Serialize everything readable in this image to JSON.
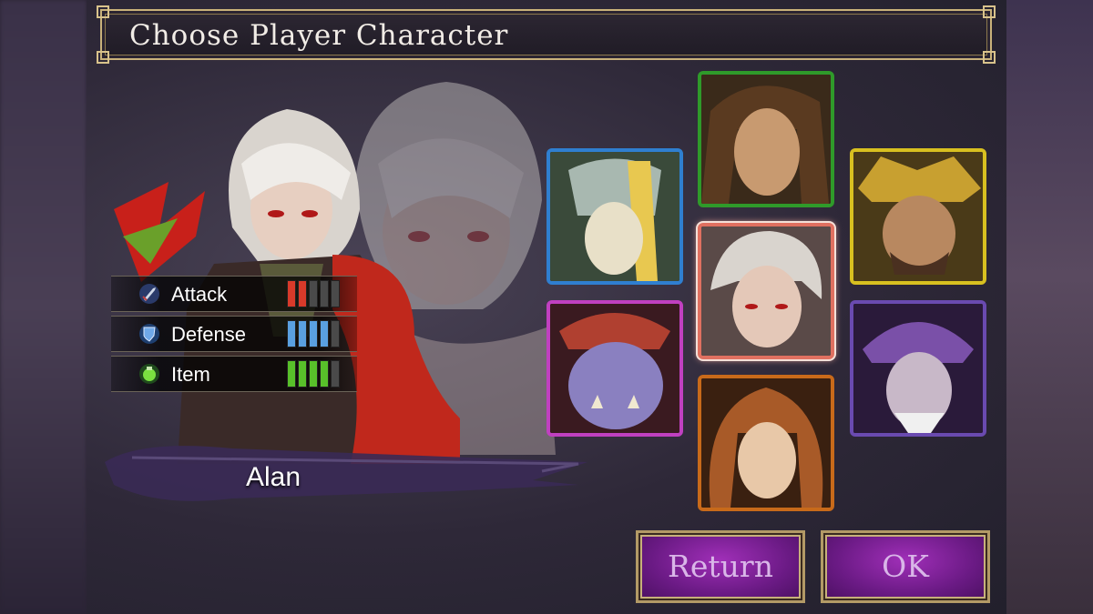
{
  "header": {
    "title": "Choose Player Character"
  },
  "selected": {
    "name": "Alan",
    "stats": [
      {
        "label": "Attack",
        "icon": "sword-icon",
        "filled": 2,
        "total": 5,
        "color": "#d83a2a"
      },
      {
        "label": "Defense",
        "icon": "shield-icon",
        "filled": 4,
        "total": 5,
        "color": "#5aa0e0"
      },
      {
        "label": "Item",
        "icon": "potion-icon",
        "filled": 4,
        "total": 5,
        "color": "#58c02a"
      }
    ]
  },
  "characters": [
    {
      "id": "valkyrie",
      "border": "#2f7fd0",
      "selected": false
    },
    {
      "id": "ronin",
      "border": "#2f9a2a",
      "selected": false
    },
    {
      "id": "alan",
      "border": "#e07060",
      "selected": true
    },
    {
      "id": "samurai",
      "border": "#d8c020",
      "selected": false
    },
    {
      "id": "oni",
      "border": "#c040c0",
      "selected": false
    },
    {
      "id": "elf",
      "border": "#c86a1a",
      "selected": false
    },
    {
      "id": "demon",
      "border": "#6a4ab0",
      "selected": false
    }
  ],
  "buttons": {
    "return_label": "Return",
    "ok_label": "OK"
  }
}
